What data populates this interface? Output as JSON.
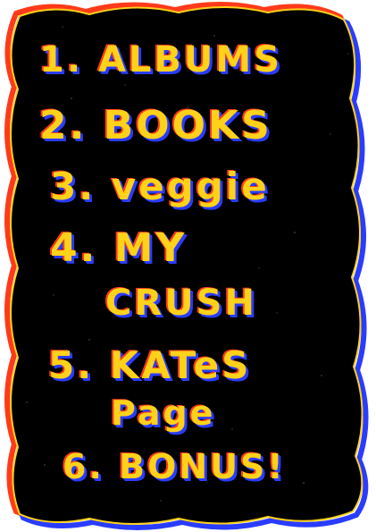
{
  "menu": {
    "items": [
      {
        "number": "1.",
        "label": "ALBUMS"
      },
      {
        "number": "2.",
        "label": "BOOKS"
      },
      {
        "number": "3.",
        "label": "veggie"
      },
      {
        "number": "4.",
        "label": "MY",
        "label_line2": "CRUSH"
      },
      {
        "number": "5.",
        "label": "KATeS",
        "label_line2": "Page"
      },
      {
        "number": "6.",
        "label": "BONUS!"
      }
    ]
  },
  "colors": {
    "background": "#000000",
    "text": "#ffd21a",
    "outline_red": "#ff3a1a",
    "outline_blue": "#2a3cff"
  }
}
